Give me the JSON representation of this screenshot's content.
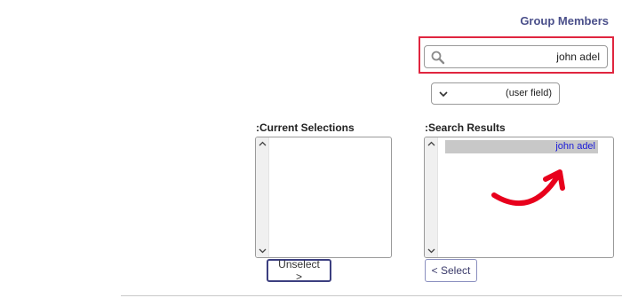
{
  "header": {
    "title": "Group Members"
  },
  "search": {
    "value": "john adel",
    "icon": "magnifier"
  },
  "filter": {
    "selected": "(user field)",
    "icon": "chevron-down"
  },
  "current_selections": {
    "label": ":Current Selections",
    "items": []
  },
  "search_results": {
    "label": ":Search Results",
    "items": [
      {
        "label": "john adel",
        "selected": true
      }
    ]
  },
  "buttons": {
    "unselect": "Unselect >",
    "select": "< Select"
  },
  "colors": {
    "title": "#4a4f8a",
    "highlight_frame": "#e0263f",
    "annotation_arrow": "#e8001c",
    "result_text": "#1a1ad8",
    "selected_row": "#c8c8c8"
  }
}
